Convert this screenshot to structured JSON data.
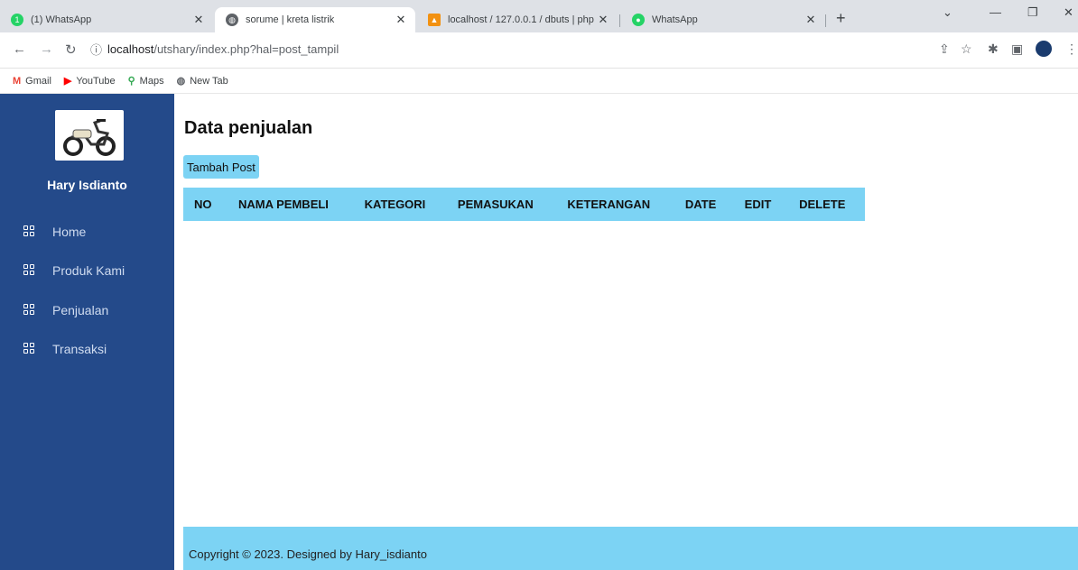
{
  "browser": {
    "tabs": [
      {
        "title": "(1) WhatsApp",
        "badge": "1",
        "active": false
      },
      {
        "title": "sorume | kreta listrik",
        "active": true
      },
      {
        "title": "localhost / 127.0.0.1 / dbuts | php",
        "active": false
      },
      {
        "title": "WhatsApp",
        "active": false
      }
    ],
    "url_host": "localhost",
    "url_path": "/utshary/index.php?hal=post_tampil",
    "bookmarks": [
      "Gmail",
      "YouTube",
      "Maps",
      "New Tab"
    ]
  },
  "sidebar": {
    "user_name": "Hary Isdianto",
    "items": [
      {
        "label": "Home",
        "icon": "grid-icon"
      },
      {
        "label": "Produk Kami",
        "icon": "grid-icon"
      },
      {
        "label": "Penjualan",
        "icon": "grid-icon"
      },
      {
        "label": "Transaksi",
        "icon": "grid-icon"
      }
    ]
  },
  "main": {
    "title": "Data penjualan",
    "add_button": "Tambah Post",
    "table": {
      "columns": [
        "NO",
        "NAMA PEMBELI",
        "KATEGORI",
        "PEMASUKAN",
        "KETERANGAN",
        "DATE",
        "EDIT",
        "DELETE"
      ]
    }
  },
  "footer": {
    "text": "Copyright © 2023. Designed by Hary_isdianto"
  },
  "colors": {
    "sidebar": "#244a8a",
    "accent": "#7cd3f4"
  }
}
